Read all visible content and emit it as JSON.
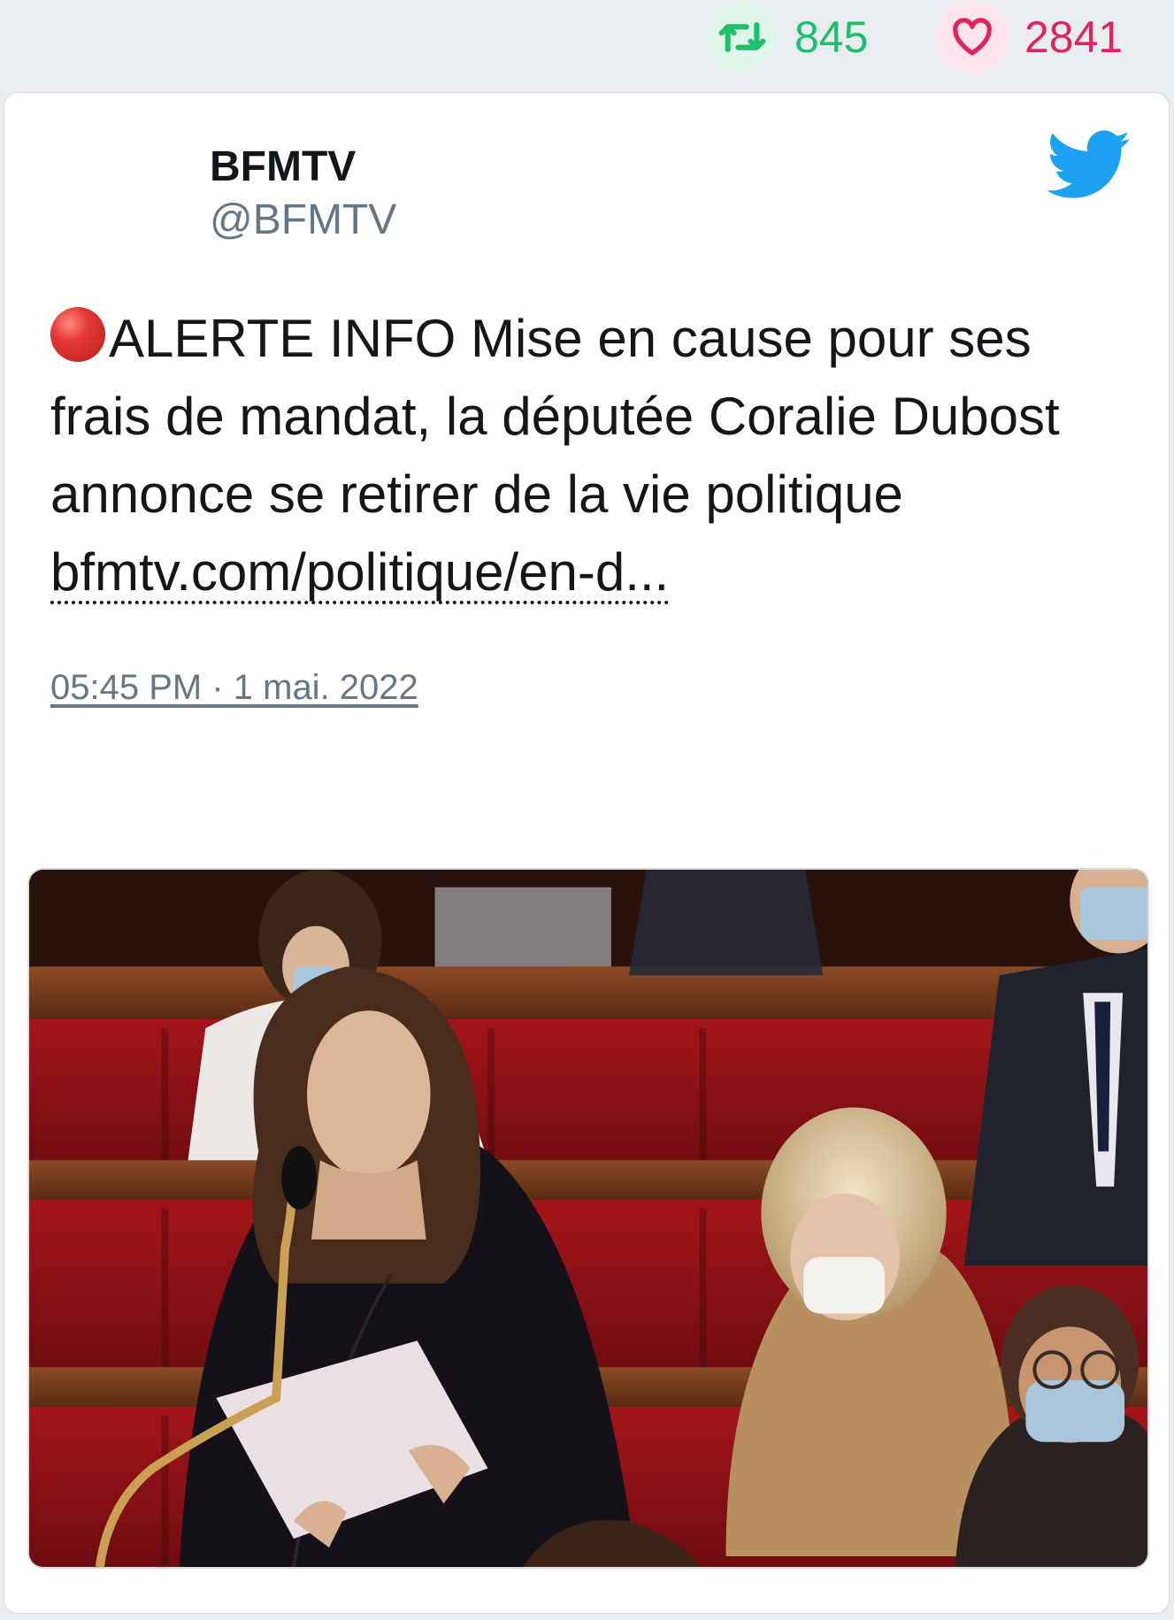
{
  "stats": {
    "retweets": "845",
    "likes": "2841",
    "retweet_icon": "retweet-icon",
    "like_icon": "heart-icon",
    "retweet_color": "#1fbf6e",
    "like_color": "#e0245e"
  },
  "tweet": {
    "author_name": "BFMTV",
    "author_handle": "@BFMTV",
    "brand_icon": "twitter-bird-icon",
    "alert_icon": "red-circle-icon",
    "text": "ALERTE INFO Mise en cause pour ses frais de mandat, la députée Coralie Dubost annonce se retirer de la vie politique ",
    "link_text": "bfmtv.com/politique/en-d...",
    "timestamp": "05:45 PM · 1 mai. 2022",
    "actions": [
      "reply-icon",
      "retweet-icon",
      "heart-icon"
    ]
  },
  "colors": {
    "brand": "#1da1f2",
    "text": "#14171a",
    "muted": "#657786",
    "background": "#e9edf0"
  }
}
